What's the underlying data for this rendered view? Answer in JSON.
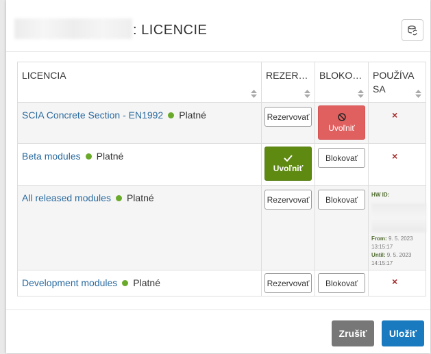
{
  "dialog": {
    "title": ": LICENCIE"
  },
  "table": {
    "headers": [
      "LICENCIA",
      "REZER…",
      "BLOKO…",
      "POUŽÍVA SA"
    ],
    "rows": [
      {
        "name": "SCIA Concrete Section - EN1992",
        "status": "Platné",
        "reserve": "Rezervovať",
        "block": "Uvoľniť",
        "in_use": "×"
      },
      {
        "name": "Beta modules",
        "status": "Platné",
        "reserve": "Uvoľniť",
        "block": "Blokovať",
        "in_use": "×"
      },
      {
        "name": "All released modules",
        "status": "Platné",
        "reserve": "Rezervovať",
        "block": "Blokovať",
        "hw_label": "HW ID:",
        "from_label": "From:",
        "from_value": "9. 5. 2023 13:15:17",
        "until_label": "Until:",
        "until_value": "9. 5. 2023 14:15:17"
      },
      {
        "name": "Development modules",
        "status": "Platné",
        "reserve": "Rezervovať",
        "block": "Blokovať",
        "in_use": "×"
      }
    ]
  },
  "footer": {
    "cancel_label": "Zrušiť",
    "save_label": "Uložiť"
  },
  "colors": {
    "link": "#2a6a9e",
    "status_dot": "#6aaa2a",
    "danger": "#e06060",
    "success": "#5e8a12",
    "primary": "#1a7ac0"
  }
}
